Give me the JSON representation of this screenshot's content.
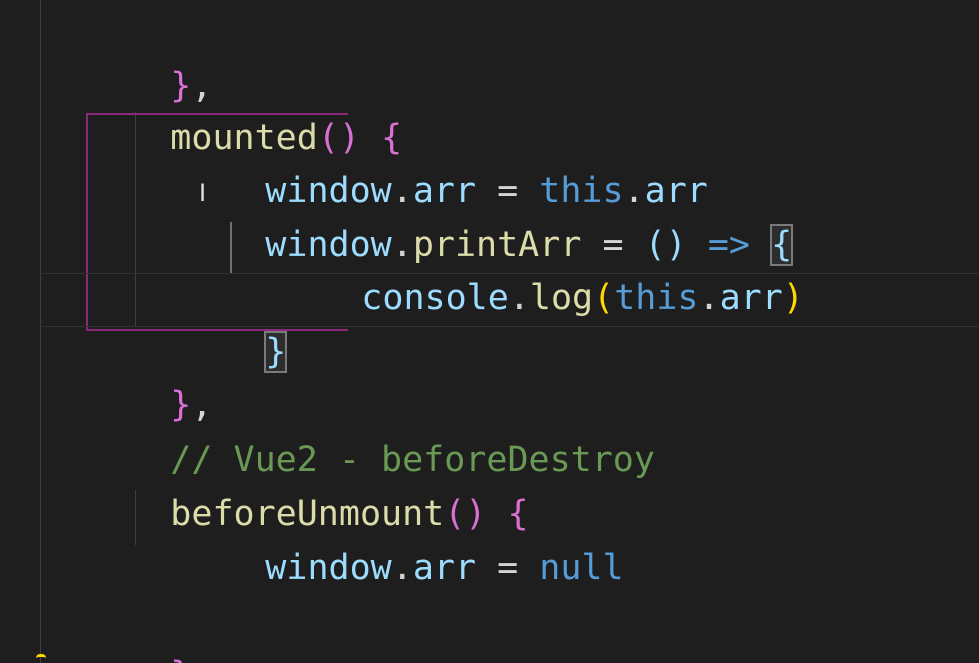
{
  "colors": {
    "background": "#1e1e1e",
    "brace_purple": "#da70d6",
    "paren_yellow": "#ffd700",
    "function_yellow": "#dcdcaa",
    "variable_blue": "#9cdcfe",
    "keyword_blue": "#569cd6",
    "comment_green": "#6a9955",
    "punctuation": "#d4d4d4"
  },
  "code": {
    "line1": {
      "brace": "}",
      "comma": ","
    },
    "line2": {
      "fn": "mounted",
      "parens": "()",
      "brace": "{"
    },
    "line3": {
      "obj": "window",
      "dot": ".",
      "prop": "arr",
      "eq": " = ",
      "kw": "this",
      "dot2": ".",
      "prop2": "arr"
    },
    "line4": {
      "obj": "window",
      "dot": ".",
      "prop": "printArr",
      "eq": " = ",
      "parens": "()",
      "arrow": " => ",
      "brace": "{"
    },
    "line5": {
      "obj": "console",
      "dot": ".",
      "method": "log",
      "open": "(",
      "kw": "this",
      "dot2": ".",
      "prop": "arr",
      "close": ")"
    },
    "line6": {
      "brace": "}"
    },
    "line7": {
      "brace": "}",
      "comma": ","
    },
    "line8": {
      "comment": "// Vue2 - beforeDestroy"
    },
    "line9": {
      "fn": "beforeUnmount",
      "parens": "()",
      "brace": "{"
    },
    "line10": {
      "obj": "window",
      "dot": ".",
      "prop": "arr",
      "eq": " = ",
      "kw": "null"
    },
    "line12": {
      "brace": "}",
      "comma": ","
    }
  }
}
